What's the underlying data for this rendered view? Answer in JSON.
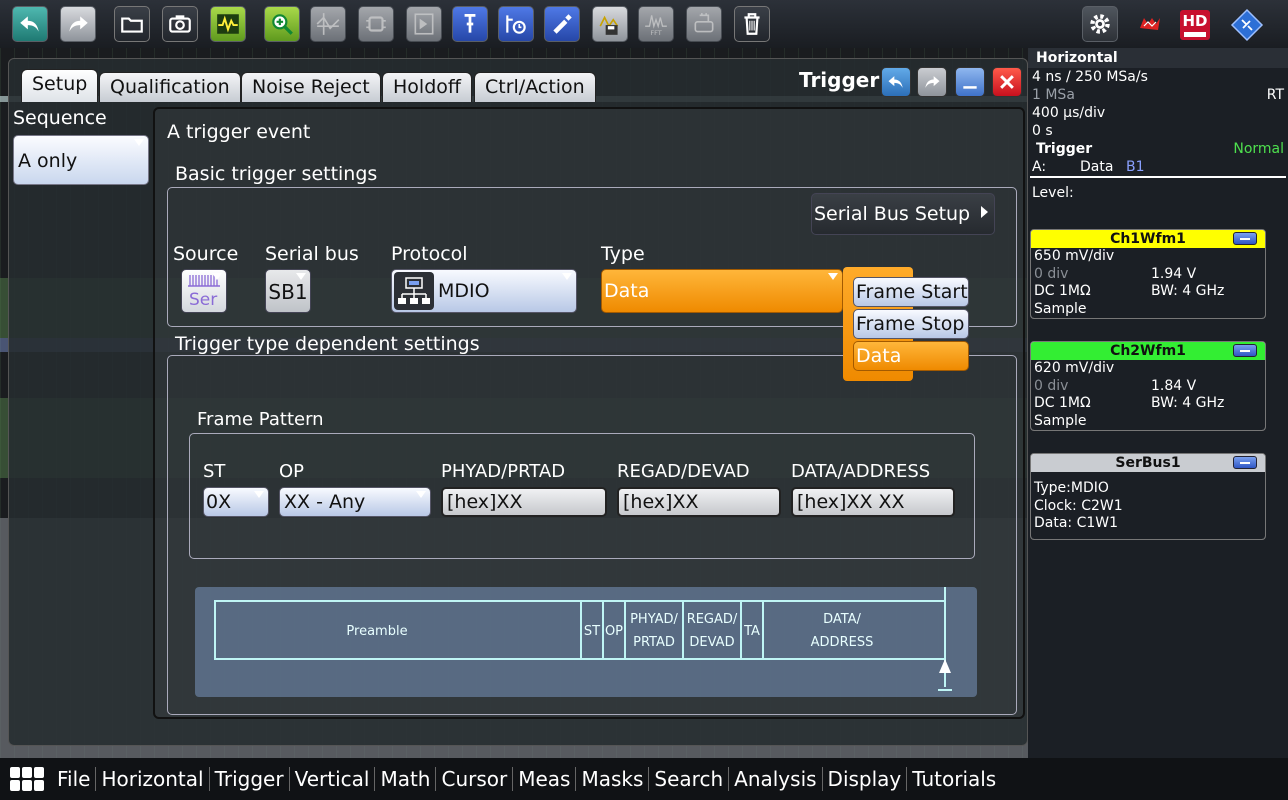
{
  "toolbar": {
    "icons": [
      "undo-icon",
      "redo-icon",
      "open-folder-icon",
      "camera-icon",
      "autoset-icon",
      "zoom-icon",
      "cursor-icon",
      "chip-icon",
      "mask-icon",
      "marker-icon",
      "histogram-icon",
      "pen-icon",
      "save-icon",
      "fft-icon",
      "print-icon",
      "trash-icon",
      "gear-icon",
      "flag-icon",
      "hd-icon",
      "rs-logo-icon"
    ],
    "hd_label": "HD",
    "fft_label": "FFT"
  },
  "dialog": {
    "tabs": [
      "Setup",
      "Qualification",
      "Noise Reject",
      "Holdoff",
      "Ctrl/Action"
    ],
    "active_tab": "Setup",
    "title": "Trigger"
  },
  "sequence": {
    "label": "Sequence",
    "value": "A only"
  },
  "event": {
    "title": "A trigger event",
    "basic_title": "Basic trigger settings",
    "serial_bus_setup": "Serial Bus Setup",
    "source": {
      "label": "Source",
      "value": "Ser"
    },
    "serial_bus": {
      "label": "Serial bus",
      "value": "SB1"
    },
    "protocol": {
      "label": "Protocol",
      "value": "MDIO"
    },
    "type": {
      "label": "Type",
      "value": "Data",
      "options": [
        "Frame Start",
        "Frame Stop",
        "Data"
      ]
    },
    "dependent_title": "Trigger type dependent settings",
    "frame_pattern": {
      "title": "Frame Pattern",
      "fields": [
        {
          "label": "ST",
          "value": "0X"
        },
        {
          "label": "OP",
          "value": "XX - Any"
        },
        {
          "label": "PHYAD/PRTAD",
          "value": "[hex]XX"
        },
        {
          "label": "REGAD/DEVAD",
          "value": "[hex]XX"
        },
        {
          "label": "DATA/ADDRESS",
          "value": "[hex]XX XX"
        }
      ]
    },
    "diagram": {
      "segments": [
        "Preamble",
        "ST",
        "OP",
        "PHYAD/",
        "PRTAD",
        "REGAD/",
        "DEVAD",
        "TA",
        "DATA/",
        "ADDRESS"
      ]
    }
  },
  "horizontal": {
    "title": "Horizontal",
    "timebase": "4 ns / 250 MSa/s",
    "record": "1 MSa",
    "mode": "RT",
    "scale": "400 µs/div",
    "position": "0 s"
  },
  "trigger_info": {
    "title": "Trigger",
    "mode": "Normal",
    "source_label": "A:",
    "source_type": "Data",
    "source_bus": "B1",
    "level_label": "Level:"
  },
  "ch1": {
    "title": "Ch1Wfm1",
    "scale": "650 mV/div",
    "offset": "0 div",
    "position": "1.94 V",
    "coupling": "DC 1MΩ",
    "bw": "BW: 4 GHz",
    "acq": "Sample",
    "color": "#ffff00"
  },
  "ch2": {
    "title": "Ch2Wfm1",
    "scale": "620 mV/div",
    "offset": "0 div",
    "position": "1.84 V",
    "coupling": "DC 1MΩ",
    "bw": "BW: 4 GHz",
    "acq": "Sample",
    "color": "#33ee33"
  },
  "serbus": {
    "title": "SerBus1",
    "type": "Type:MDIO",
    "clock": "Clock: C2W1",
    "data": "Data:  C1W1"
  },
  "menu": [
    "File",
    "Horizontal",
    "Trigger",
    "Vertical",
    "Math",
    "Cursor",
    "Meas",
    "Masks",
    "Search",
    "Analysis",
    "Display",
    "Tutorials"
  ]
}
